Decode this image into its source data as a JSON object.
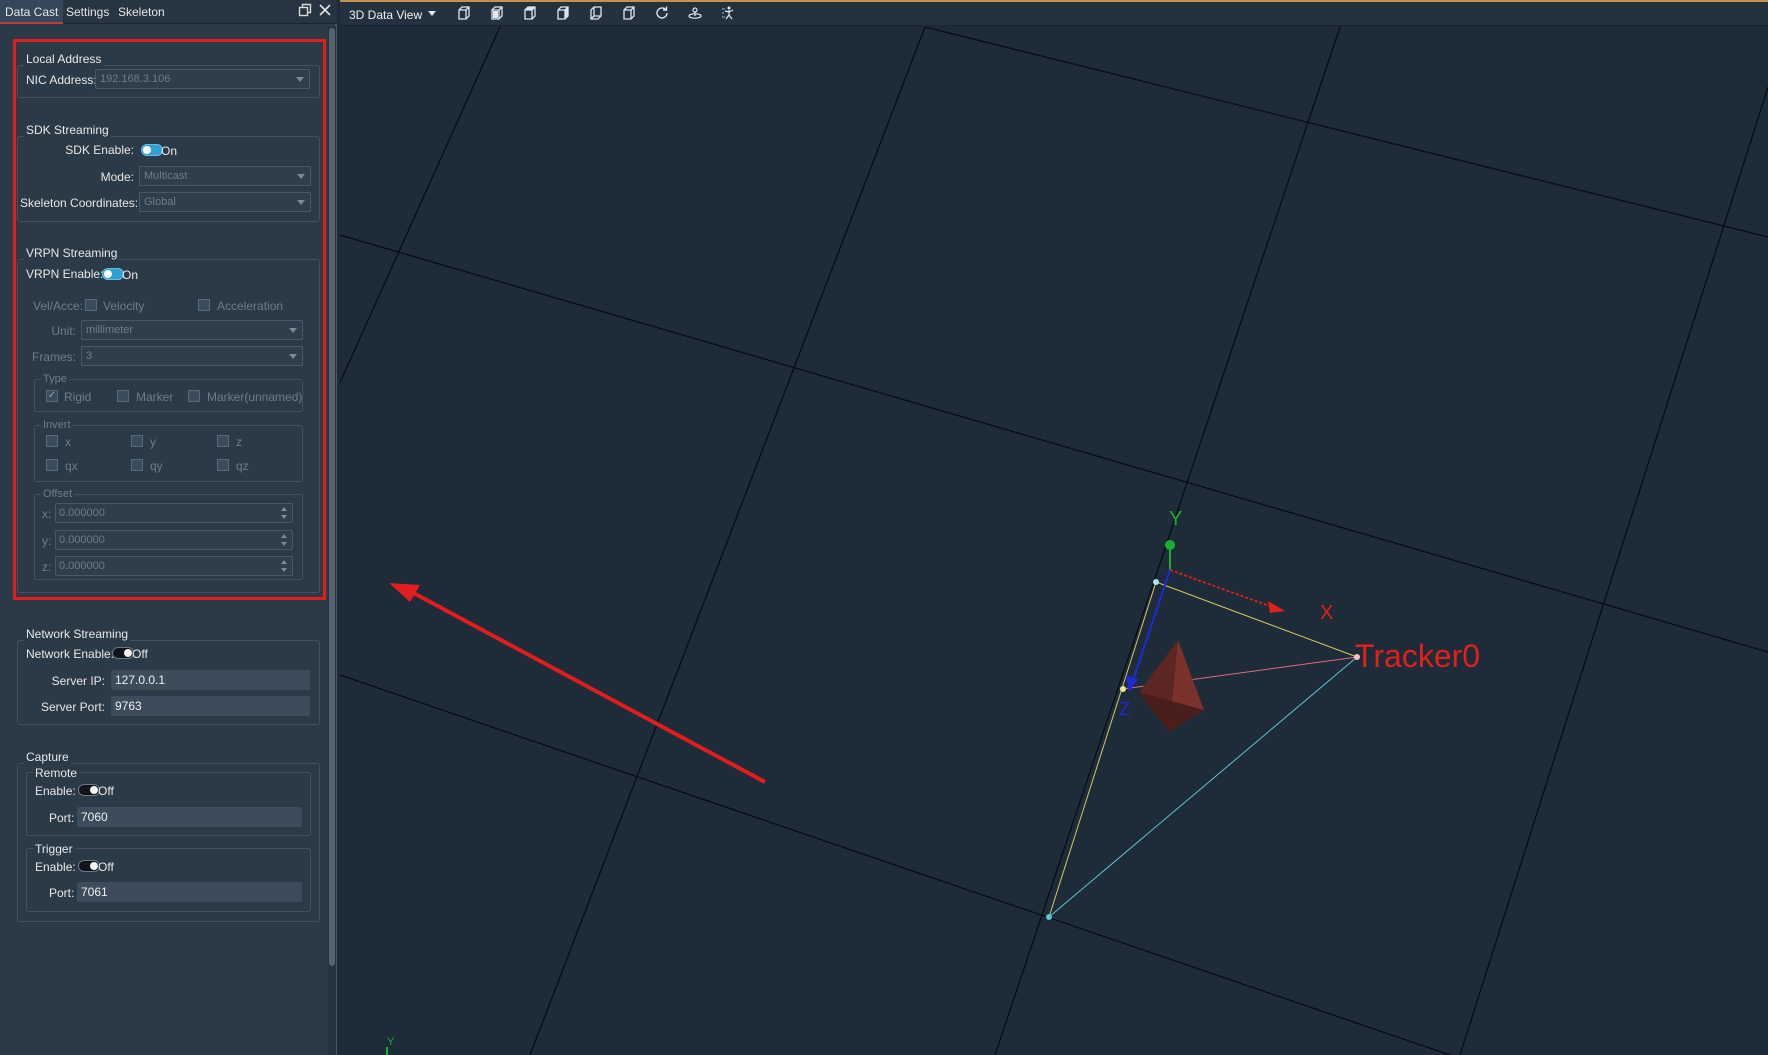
{
  "tabs": [
    "Data Cast",
    "Settings",
    "Skeleton"
  ],
  "panel_icons": [
    "restore-icon",
    "close-icon"
  ],
  "local_address": {
    "title": "Local Address",
    "nic_label": "NIC Address:",
    "nic_value": "192.168.3.106"
  },
  "sdk_streaming": {
    "title": "SDK Streaming",
    "enable_label": "SDK Enable:",
    "enable_state": "On",
    "mode_label": "Mode:",
    "mode_value": "Multicast",
    "coords_label": "Skeleton Coordinates:",
    "coords_value": "Global"
  },
  "vrpn_streaming": {
    "title": "VRPN Streaming",
    "enable_label": "VRPN Enable:",
    "enable_state": "On",
    "velacc_label": "Vel/Acce:",
    "velocity_label": "Velocity",
    "acceleration_label": "Acceleration",
    "unit_label": "Unit:",
    "unit_value": "millimeter",
    "frames_label": "Frames:",
    "frames_value": "3",
    "type_title": "Type",
    "type_rigid": "Rigid",
    "type_marker": "Marker",
    "type_marker_unnamed": "Marker(unnamed)",
    "invert_title": "Invert",
    "invert_x": "x",
    "invert_y": "y",
    "invert_z": "z",
    "invert_qx": "qx",
    "invert_qy": "qy",
    "invert_qz": "qz",
    "offset_title": "Offset",
    "offset_x_label": "x:",
    "offset_x": "0.000000",
    "offset_y_label": "y:",
    "offset_y": "0.000000",
    "offset_z_label": "z:",
    "offset_z": "0.000000"
  },
  "network_streaming": {
    "title": "Network Streaming",
    "enable_label": "Network Enable:",
    "enable_state": "Off",
    "server_ip_label": "Server IP:",
    "server_ip": "127.0.0.1",
    "server_port_label": "Server Port:",
    "server_port": "9763"
  },
  "capture": {
    "title": "Capture",
    "remote_title": "Remote",
    "remote_enable_label": "Enable:",
    "remote_enable_state": "Off",
    "remote_port_label": "Port:",
    "remote_port": "7060",
    "trigger_title": "Trigger",
    "trigger_enable_label": "Enable:",
    "trigger_enable_state": "Off",
    "trigger_port_label": "Port:",
    "trigger_port": "7061"
  },
  "view": {
    "title": "3D Data View",
    "toolbar_icons": [
      "dropdown-icon",
      "view-persp-icon",
      "view-front-icon",
      "view-top-icon",
      "view-side-icon",
      "view-back-icon",
      "view-right-icon",
      "refresh-icon",
      "tracking-icon",
      "skeleton-icon"
    ],
    "tracker_label": "Tracker0",
    "axis_x": "X",
    "axis_y": "Y",
    "axis_z": "Z",
    "corner_axis_y": "Y"
  },
  "colors": {
    "highlight": "#e11d1d",
    "toggle_on": "#2f9fd4",
    "axis_x": "#e0201a",
    "axis_y": "#18b030",
    "axis_z": "#1e2ad8",
    "rigid_body": "#6b2a26"
  }
}
